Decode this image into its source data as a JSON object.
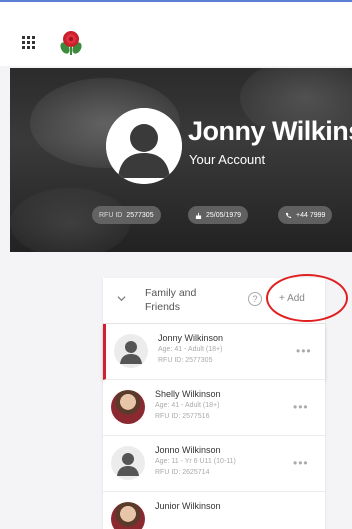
{
  "hero": {
    "name": "Jonny Wilkins",
    "subtitle": "Your Account",
    "chips": [
      {
        "label": "RFU ID",
        "value": "2577305"
      },
      {
        "icon": "cake-icon",
        "value": "25/05/1979"
      },
      {
        "icon": "phone-icon",
        "value": "+44 7999"
      }
    ]
  },
  "panel": {
    "title": "Family and Friends",
    "help": "?",
    "add_label": "+ Add",
    "members": [
      {
        "name": "Jonny Wilkinson",
        "age": "Age: 41 - Adult (18+)",
        "rfu": "RFU ID: 2577305",
        "active": true
      },
      {
        "name": "Shelly Wilkinson",
        "age": "Age: 41 - Adult (18+)",
        "rfu": "RFU ID: 2577516",
        "photo": true
      },
      {
        "name": "Jonno Wilkinson",
        "age": "Age: 11 - Yr 6 U11 (10-11)",
        "rfu": "RFU ID: 2625714"
      },
      {
        "name": "Junior Wilkinson"
      }
    ],
    "more": "•••"
  },
  "colors": {
    "accent": "#d0202f",
    "annotation": "#e02020"
  }
}
